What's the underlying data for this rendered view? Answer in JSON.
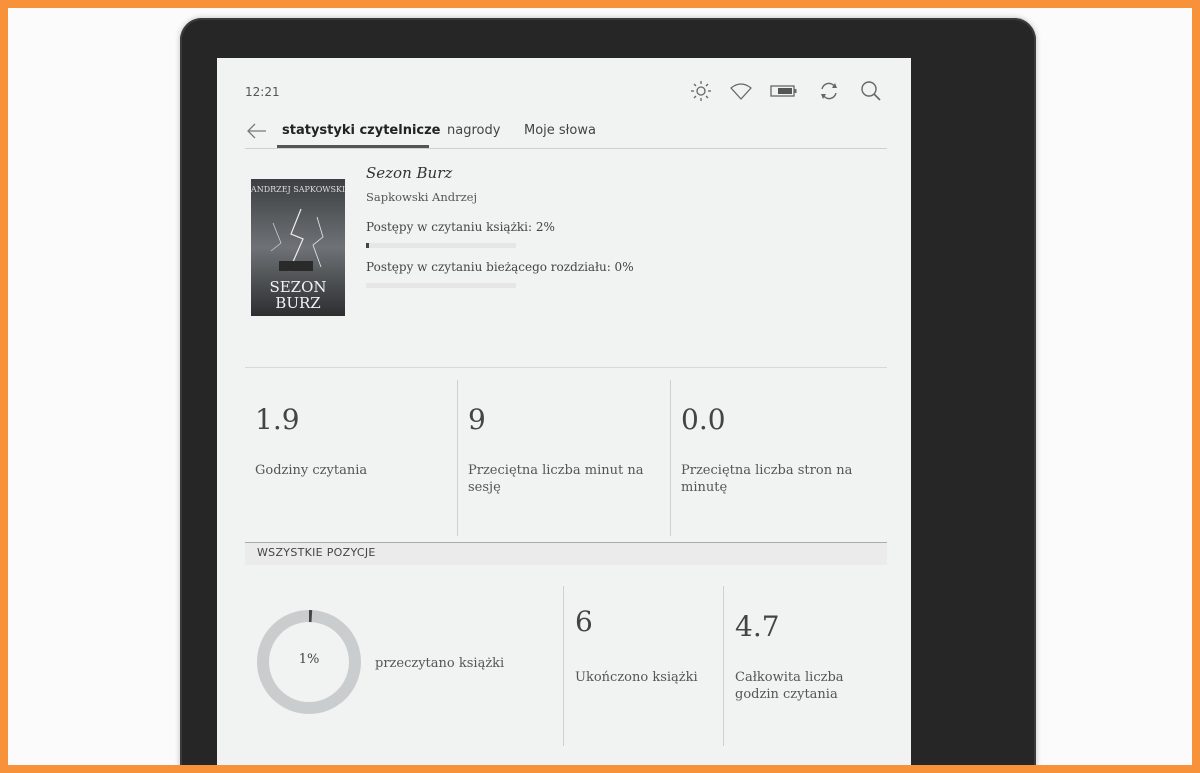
{
  "status": {
    "time": "12:21"
  },
  "nav": {
    "tabs": [
      {
        "label": "statystyki czytelnicze",
        "active": true
      },
      {
        "label": "nagrody",
        "active": false
      },
      {
        "label": "Moje słowa",
        "active": false
      }
    ]
  },
  "book": {
    "title": "Sezon Burz",
    "author": "Sapkowski Andrzej",
    "cover": {
      "top_text": "ANDRZEJ SAPKOWSKI",
      "title_line1": "SEZON",
      "title_line2": "BURZ"
    },
    "book_progress_label": "Postępy w czytaniu książki: 2%",
    "book_progress_value": 2,
    "chapter_progress_label": "Postępy w czytaniu bieżącego rozdziału: 0%",
    "chapter_progress_value": 0
  },
  "stats": [
    {
      "value": "1.9",
      "label": "Godziny czytania"
    },
    {
      "value": "9",
      "label": "Przeciętna liczba minut na sesję"
    },
    {
      "value": "0.0",
      "label": "Przeciętna liczba stron na minutę"
    }
  ],
  "all_items": {
    "header": "WSZYSTKIE POZYCJE",
    "donut_value": "1%",
    "donut_fraction": 0.01,
    "donut_label": "przeczytano książki",
    "finished_value": "6",
    "finished_label": "Ukończono książki",
    "total_hours_value": "4.7",
    "total_hours_label": "Całkowita liczba godzin czytania"
  },
  "colors": {
    "accent": "#555555",
    "background": "#f7913a",
    "device": "#262626",
    "screen": "#f1f2f2"
  }
}
